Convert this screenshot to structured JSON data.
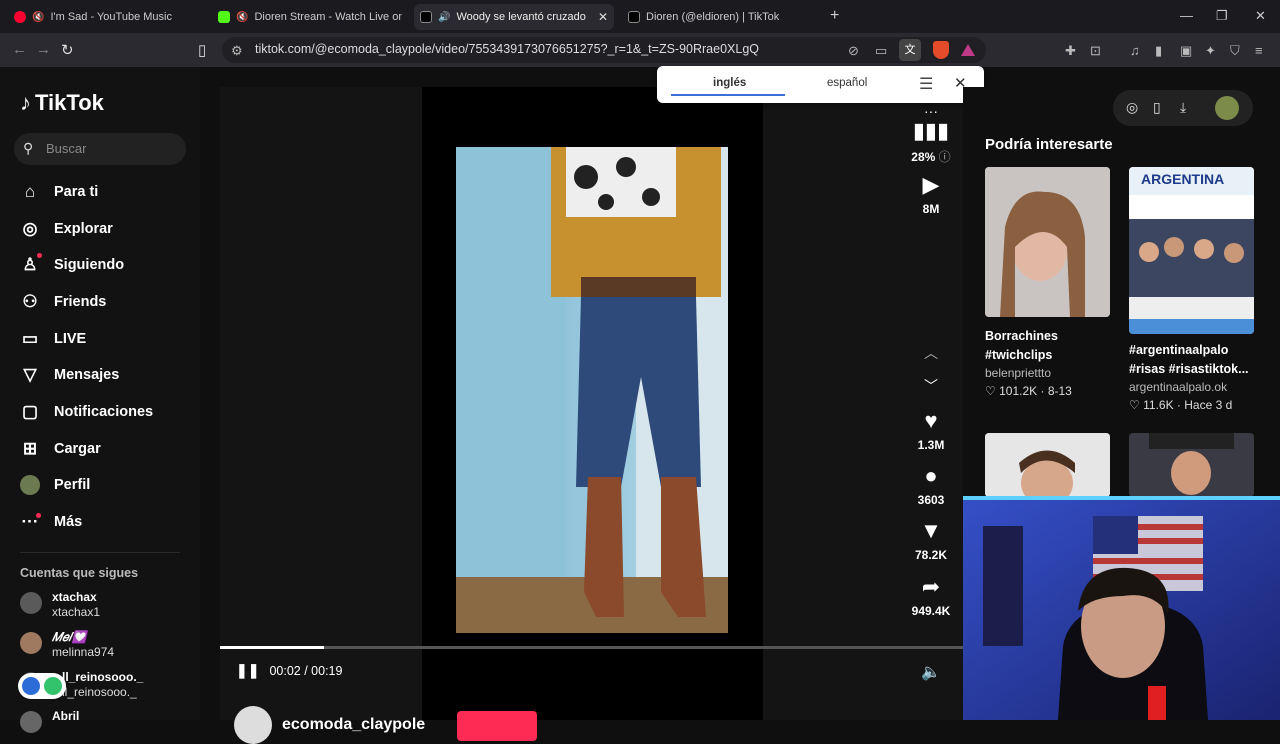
{
  "browser": {
    "tabs": [
      {
        "title": "I'm Sad - YouTube Music",
        "active": false
      },
      {
        "title": "Dioren Stream - Watch Live on Ki",
        "active": false
      },
      {
        "title": "Woody se levantó cruzado: ¡C",
        "active": true
      },
      {
        "title": "Dioren (@eldioren) | TikTok",
        "active": false
      }
    ],
    "url": "tiktok.com/@ecomoda_claypole/video/7553439173076651275?_r=1&_t=ZS-90Rrae0XLgQ"
  },
  "translate_popup": {
    "source": "inglés",
    "target": "español"
  },
  "sidebar": {
    "logo": "TikTok",
    "search_placeholder": "Buscar",
    "nav": [
      {
        "label": "Para ti",
        "icon": "home-icon"
      },
      {
        "label": "Explorar",
        "icon": "compass-icon"
      },
      {
        "label": "Siguiendo",
        "icon": "user-follow-icon"
      },
      {
        "label": "Friends",
        "icon": "friends-icon"
      },
      {
        "label": "LIVE",
        "icon": "live-icon"
      },
      {
        "label": "Mensajes",
        "icon": "send-icon"
      },
      {
        "label": "Notificaciones",
        "icon": "notifications-icon"
      },
      {
        "label": "Cargar",
        "icon": "upload-icon"
      },
      {
        "label": "Perfil",
        "icon": "avatar"
      },
      {
        "label": "Más",
        "icon": "more-icon"
      }
    ],
    "following_title": "Cuentas que sigues",
    "following": [
      {
        "name": "xtachax",
        "user": "xtachax1"
      },
      {
        "name": "𝑀𝑒𝑙💟",
        "user": "melinna974"
      },
      {
        "name": "...ll_reinosooo._",
        "user": "...ll_reinosooo._"
      },
      {
        "name": "Abril",
        "user": ""
      }
    ]
  },
  "player": {
    "current_time": "00:02",
    "duration": "00:19",
    "progress_fraction": 0.14,
    "author": "ecomoda_claypole",
    "actions": {
      "audio_percent": "28%",
      "plays": "8M",
      "likes": "1.3M",
      "comments": "3603",
      "saves": "78.2K",
      "shares": "949.4K"
    }
  },
  "recommendations": {
    "title": "Podría interesarte",
    "cards": [
      {
        "caption": "Borrachines #twichclips",
        "author": "belenpriettto",
        "likes": "101.2K",
        "date": "8-13"
      },
      {
        "caption": "#argentinaalpalo #risas #risastiktok...",
        "author": "argentinaalpalo.ok",
        "likes": "11.6K",
        "date": "Hace 3 d"
      }
    ],
    "banner_text": "ARGENTINA"
  },
  "colors": {
    "accent": "#fe2c55",
    "background": "#0f0f0f"
  }
}
